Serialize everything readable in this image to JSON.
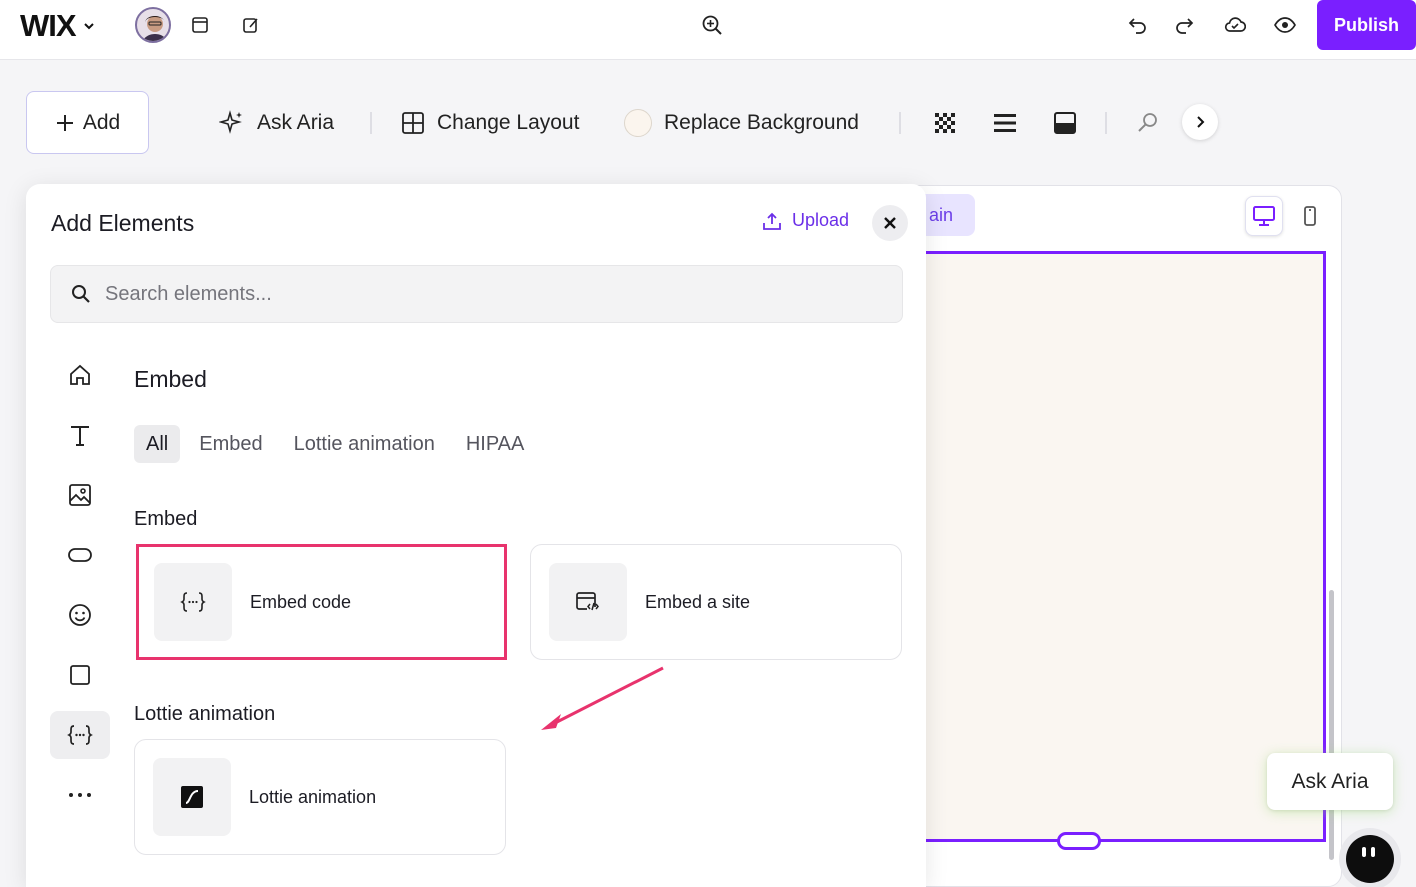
{
  "topbar": {
    "logo": "WIX",
    "publish_label": "Publish"
  },
  "toolbar": {
    "add_label": "Add",
    "ask_aria_label": "Ask Aria",
    "change_layout_label": "Change Layout",
    "replace_background_label": "Replace Background"
  },
  "canvas": {
    "page_pill_label": "ain",
    "ask_aria_float_label": "Ask Aria"
  },
  "panel": {
    "title": "Add Elements",
    "upload_label": "Upload",
    "search_placeholder": "Search elements...",
    "section_heading": "Embed",
    "filter_tabs": [
      "All",
      "Embed",
      "Lottie animation",
      "HIPAA"
    ],
    "active_tab": "All",
    "groups": [
      {
        "label": "Embed",
        "items": [
          {
            "label": "Embed code",
            "icon": "code-braces-icon"
          },
          {
            "label": "Embed a site",
            "icon": "embed-site-icon"
          }
        ]
      },
      {
        "label": "Lottie animation",
        "items": [
          {
            "label": "Lottie animation",
            "icon": "lottie-icon"
          }
        ]
      }
    ],
    "categories": [
      "home-icon",
      "text-icon",
      "image-icon",
      "button-icon",
      "smiley-icon",
      "box-icon",
      "embed-code-icon",
      "more-icon"
    ],
    "active_category": "embed-code-icon"
  },
  "colors": {
    "accent": "#7a1fff",
    "highlight": "#e8336d",
    "link": "#6b2fe8"
  }
}
